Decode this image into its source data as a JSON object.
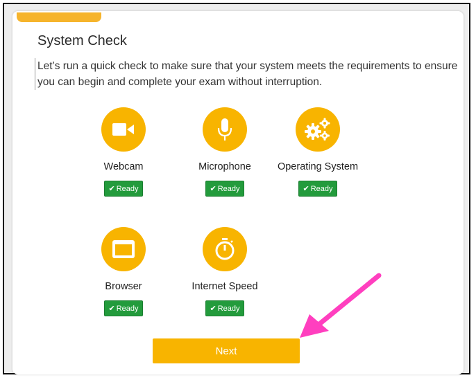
{
  "page": {
    "title": "System Check",
    "description": "Let’s run a quick check to make sure that your system meets the requirements to ensure you can begin and complete your exam without interruption."
  },
  "checks": [
    {
      "label": "Webcam",
      "status": "Ready",
      "icon": "video-camera-icon"
    },
    {
      "label": "Microphone",
      "status": "Ready",
      "icon": "microphone-icon"
    },
    {
      "label": "Operating System",
      "status": "Ready",
      "icon": "gears-icon"
    },
    {
      "label": "Browser",
      "status": "Ready",
      "icon": "browser-window-icon"
    },
    {
      "label": "Internet Speed",
      "status": "Ready",
      "icon": "stopwatch-icon"
    }
  ],
  "next_button": {
    "label": "Next"
  },
  "colors": {
    "accent": "#f8b400",
    "ready_green": "#239b3c",
    "annotation_arrow": "#ff3fbf"
  }
}
